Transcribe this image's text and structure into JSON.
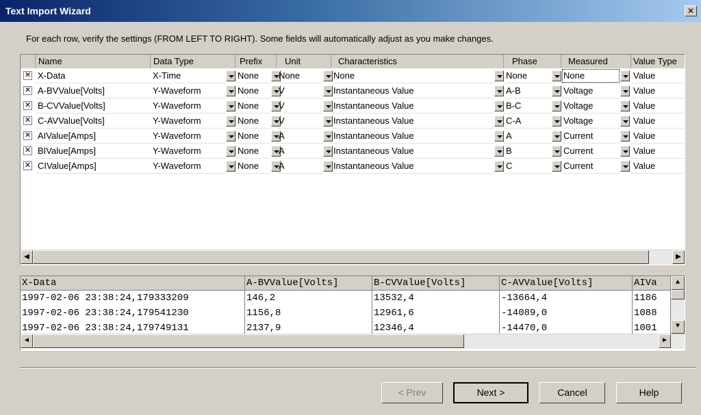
{
  "window": {
    "title": "Text Import Wizard",
    "close_glyph": "✕"
  },
  "instructions": "For each row, verify the settings (FROM LEFT TO RIGHT). Some fields will automatically adjust as you make changes.",
  "grid": {
    "headers": [
      "Name",
      "Data Type",
      "Prefix",
      "Unit",
      "Characteristics",
      "Phase",
      "Measured",
      "Value Type"
    ],
    "rows": [
      {
        "checked": true,
        "name": "X-Data",
        "data_type": "X-Time",
        "prefix": "None",
        "unit": "None",
        "characteristics": "None",
        "phase": "None",
        "measured": "None",
        "value_type": "Value"
      },
      {
        "checked": true,
        "name": "A-BVValue[Volts]",
        "data_type": "Y-Waveform",
        "prefix": "None",
        "unit": "V",
        "characteristics": "Instantaneous Value",
        "phase": "A-B",
        "measured": "Voltage",
        "value_type": "Value"
      },
      {
        "checked": true,
        "name": "B-CVValue[Volts]",
        "data_type": "Y-Waveform",
        "prefix": "None",
        "unit": "V",
        "characteristics": "Instantaneous Value",
        "phase": "B-C",
        "measured": "Voltage",
        "value_type": "Value"
      },
      {
        "checked": true,
        "name": "C-AVValue[Volts]",
        "data_type": "Y-Waveform",
        "prefix": "None",
        "unit": "V",
        "characteristics": "Instantaneous Value",
        "phase": "C-A",
        "measured": "Voltage",
        "value_type": "Value"
      },
      {
        "checked": true,
        "name": "AIValue[Amps]",
        "data_type": "Y-Waveform",
        "prefix": "None",
        "unit": "A",
        "characteristics": "Instantaneous Value",
        "phase": "A",
        "measured": "Current",
        "value_type": "Value"
      },
      {
        "checked": true,
        "name": "BIValue[Amps]",
        "data_type": "Y-Waveform",
        "prefix": "None",
        "unit": "A",
        "characteristics": "Instantaneous Value",
        "phase": "B",
        "measured": "Current",
        "value_type": "Value"
      },
      {
        "checked": true,
        "name": "CIValue[Amps]",
        "data_type": "Y-Waveform",
        "prefix": "None",
        "unit": "A",
        "characteristics": "Instantaneous Value",
        "phase": "C",
        "measured": "Current",
        "value_type": "Value"
      }
    ]
  },
  "preview": {
    "headers": [
      "X-Data",
      "A-BVValue[Volts]",
      "B-CVValue[Volts]",
      "C-AVValue[Volts]",
      "AIVa"
    ],
    "rows": [
      [
        "1997-02-06 23:38:24,179333209",
        "146,2",
        "13532,4",
        "-13664,4",
        "1186"
      ],
      [
        "1997-02-06 23:38:24,179541230",
        "1156,8",
        "12961,6",
        "-14089,0",
        "1088"
      ],
      [
        "1997-02-06 23:38:24,179749131",
        "2137,9",
        "12346,4",
        "-14470,0",
        "1001"
      ]
    ]
  },
  "buttons": {
    "prev": "< Prev",
    "next": "Next >",
    "cancel": "Cancel",
    "help": "Help"
  },
  "scroll": {
    "left": "◀",
    "right": "▶",
    "up": "▲",
    "down": "▼"
  },
  "icons": {
    "checkbox_checked": "✕"
  }
}
